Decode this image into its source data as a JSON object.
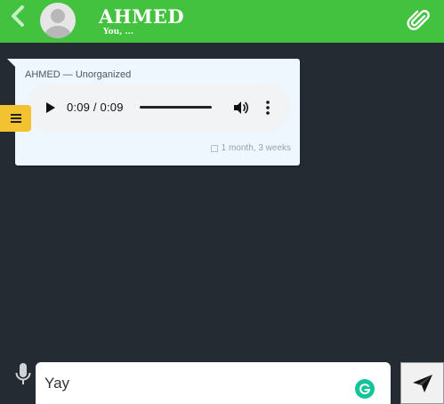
{
  "header": {
    "contact_name": "AHMED",
    "contact_status": "You, ...",
    "accent_color": "#43c23f",
    "back_icon": "chevron-left-icon",
    "attach_icon": "paperclip-icon"
  },
  "conversation": {
    "background_color": "#252b33",
    "messages": [
      {
        "sender": "AHMED — Unorganized",
        "type": "audio",
        "audio_time": "0:09 / 0:09",
        "timestamp": "1 month, 3 weeks"
      }
    ]
  },
  "side_menu": {
    "icon": "hamburger-icon",
    "color": "#f2c230"
  },
  "composer": {
    "mic_icon": "microphone-icon",
    "input_value": "Yay",
    "send_icon": "send-icon",
    "grammarly_icon": "grammarly-icon"
  }
}
